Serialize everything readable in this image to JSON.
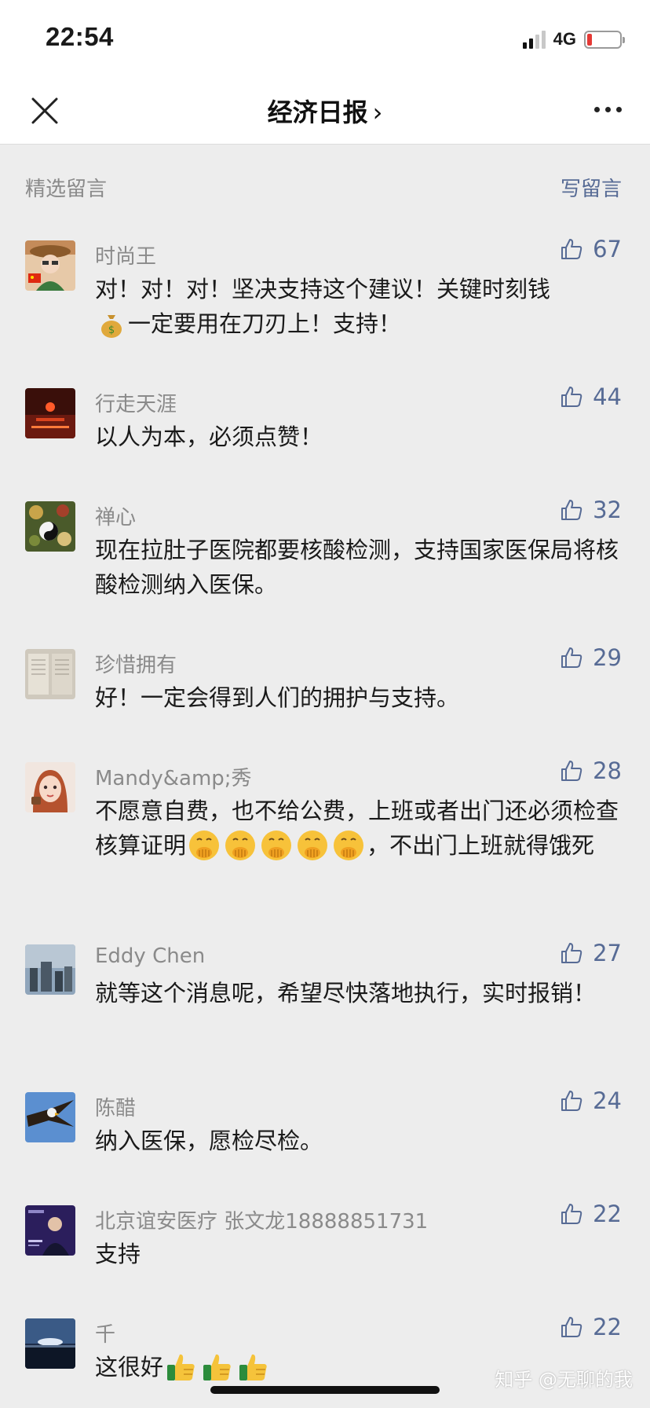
{
  "status_bar": {
    "time": "22:54",
    "network": "4G",
    "battery_level": 0.1
  },
  "nav": {
    "title": "经济日报",
    "title_chevron": "›"
  },
  "section": {
    "title": "精选留言",
    "write_label": "写留言"
  },
  "comments": [
    {
      "name": "时尚王",
      "likes": "67",
      "text_a": "对！对！对！坚决支持这个建议！关键时刻钱",
      "text_b": "一定要用在刀刃上！支持！"
    },
    {
      "name": "行走天涯",
      "likes": "44",
      "text": "以人为本，必须点赞！"
    },
    {
      "name": "禅心",
      "likes": "32",
      "text": "现在拉肚子医院都要核酸检测，支持国家医保局将核酸检测纳入医保。"
    },
    {
      "name": "珍惜拥有",
      "likes": "29",
      "text": "好！一定会得到人们的拥护与支持。"
    },
    {
      "name": "Mandy&amp;秀",
      "likes": "28",
      "text_a": "不愿意自费，也不给公费，上班或者出门还必须检查核算证明",
      "text_b": "，不出门上班就得饿死"
    },
    {
      "name": "Eddy Chen",
      "likes": "27",
      "text": "就等这个消息呢，希望尽快落地执行，实时报销！"
    },
    {
      "name": "陈醋",
      "likes": "24",
      "text": "纳入医保，愿检尽检。"
    },
    {
      "name": "北京谊安医疗 张文龙18888851731",
      "likes": "22",
      "text": "支持"
    },
    {
      "name": "千",
      "likes": "22",
      "text": "这很好"
    }
  ],
  "icons": {
    "close": "close-icon",
    "more": "more-icon",
    "like": "thumbs-up-icon",
    "coin": "money-bag-emoji",
    "shush": "face-with-hand-over-mouth-emoji",
    "thumb": "thumbs-up-emoji"
  },
  "colors": {
    "link": "#576b95",
    "meta": "#8a8a8a",
    "background": "#ededed"
  },
  "watermark": "知乎 @无聊的我"
}
